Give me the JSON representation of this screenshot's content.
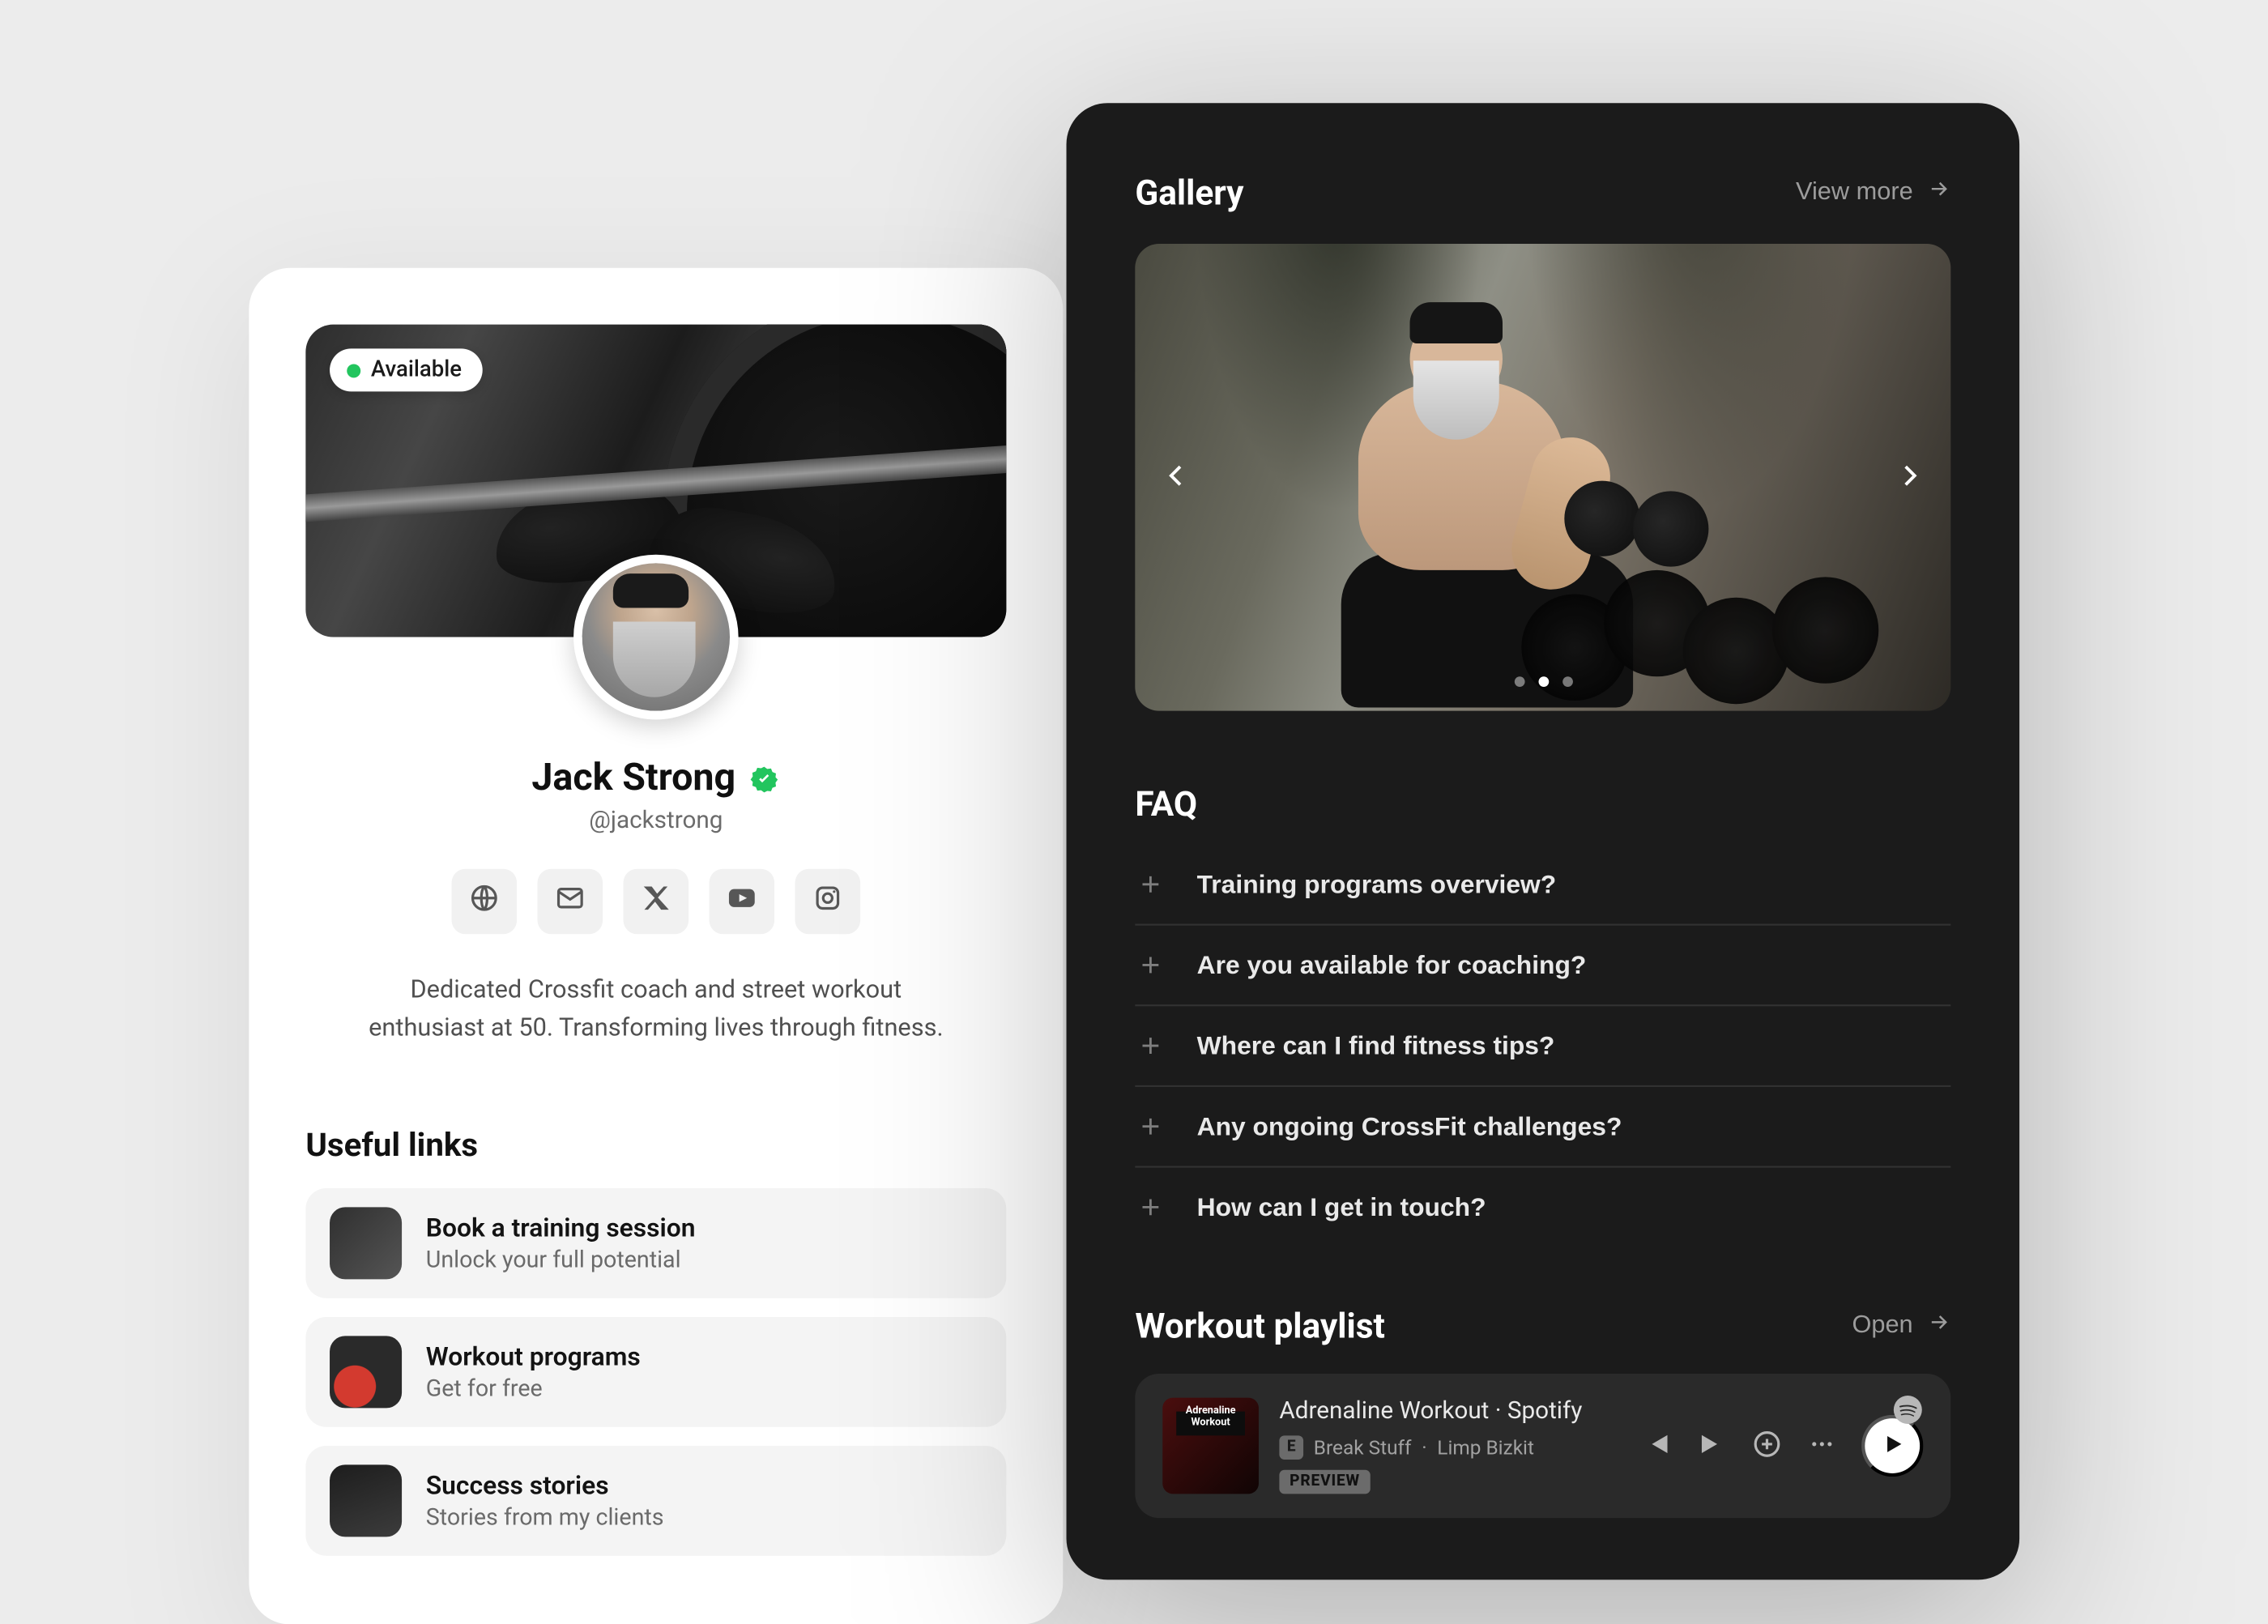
{
  "profile": {
    "status_label": "Available",
    "name": "Jack Strong",
    "handle": "@jackstrong",
    "bio": "Dedicated Crossfit coach and street workout enthusiast at 50. Transforming lives through fitness.",
    "links_title": "Useful links",
    "links": [
      {
        "title": "Book a training session",
        "subtitle": "Unlock your full potential"
      },
      {
        "title": "Workout programs",
        "subtitle": "Get for free"
      },
      {
        "title": "Success stories",
        "subtitle": "Stories from my clients"
      }
    ]
  },
  "gallery": {
    "title": "Gallery",
    "view_more": "View more",
    "active_dot": 1,
    "dot_count": 3
  },
  "faq": {
    "title": "FAQ",
    "items": [
      "Training programs overview?",
      "Are you available for coaching?",
      "Where can I find fitness tips?",
      "Any ongoing CrossFit challenges?",
      "How can I get in touch?"
    ]
  },
  "playlist": {
    "title": "Workout playlist",
    "open_label": "Open",
    "album_label": "Adrenaline Workout",
    "track_title": "Adrenaline Workout · Spotify",
    "explicit": "E",
    "song": "Break Stuff",
    "separator": "·",
    "artist": "Limp Bizkit",
    "preview": "PREVIEW"
  }
}
